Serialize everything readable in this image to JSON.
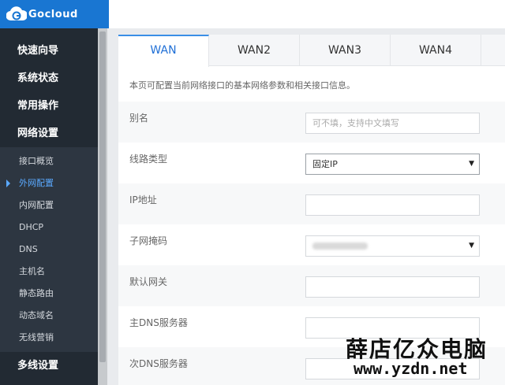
{
  "brand": {
    "name": "Gocloud",
    "logo_color": "#1976d2"
  },
  "sidebar": {
    "groups_top": [
      "快速向导",
      "系统状态",
      "常用操作",
      "网络设置"
    ],
    "sub_items": [
      "接口概览",
      "外网配置",
      "内网配置",
      "DHCP",
      "DNS",
      "主机名",
      "静态路由",
      "动态域名",
      "无线营销"
    ],
    "active_sub": "外网配置",
    "groups_bottom": [
      "多线设置"
    ],
    "bg_color": "#222a33",
    "active_color": "#5aa9ff"
  },
  "tabs": [
    {
      "label": "WAN",
      "active": true
    },
    {
      "label": "WAN2",
      "active": false
    },
    {
      "label": "WAN3",
      "active": false
    },
    {
      "label": "WAN4",
      "active": false
    }
  ],
  "description": "本页可配置当前网络接口的基本网络参数和相关接口信息。",
  "form": {
    "alias": {
      "label": "别名",
      "value": "",
      "placeholder": "可不填，支持中文填写"
    },
    "line_type": {
      "label": "线路类型",
      "selected": "固定IP",
      "icon": "chevron-down-icon"
    },
    "ip_address": {
      "label": "IP地址",
      "value": ""
    },
    "subnet_mask": {
      "label": "子网掩码",
      "selected": "",
      "icon": "chevron-down-icon"
    },
    "gateway": {
      "label": "默认网关",
      "value": ""
    },
    "dns_primary": {
      "label": "主DNS服务器",
      "value": ""
    },
    "dns_secondary": {
      "label": "次DNS服务器",
      "value": ""
    }
  },
  "watermark": {
    "cn": "薛店亿众电脑",
    "url": "www.yzdn.net"
  }
}
